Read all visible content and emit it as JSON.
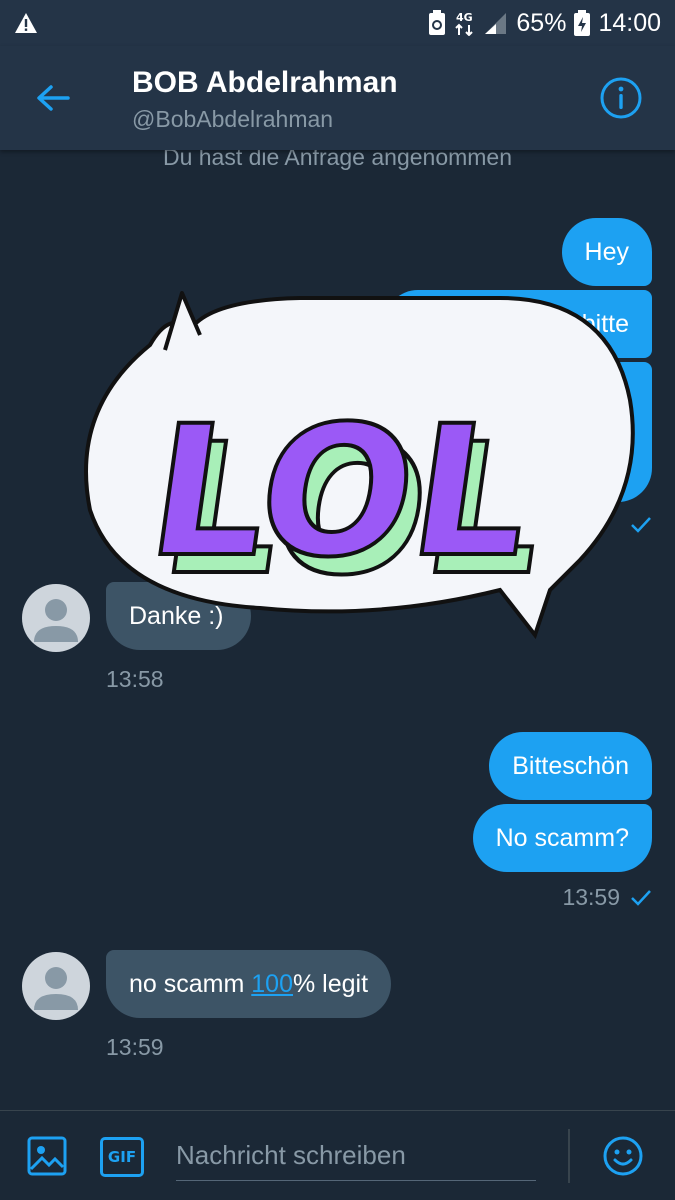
{
  "status_bar": {
    "battery": "65%",
    "time": "14:00",
    "network": "4G",
    "icons": [
      "warning-icon",
      "battery-saver-icon",
      "network-4g-icon",
      "signal-icon",
      "battery-charging-icon"
    ]
  },
  "header": {
    "name": "BOB Abdelrahman",
    "handle": "@BobAbdelrahman",
    "back_icon": "back-arrow-icon",
    "info_icon": "info-icon"
  },
  "conversation": {
    "system_note": "Du hast die Anfrage angenommen",
    "sent_group_1": [
      "Hey",
      "bitte"
    ],
    "received_1": {
      "text": "Danke :)",
      "time": "13:58"
    },
    "sent_group_2": {
      "messages": [
        "Bitteschön",
        "No scamm?"
      ],
      "time": "13:59"
    },
    "received_2": {
      "text_before": "no scamm ",
      "link": "100",
      "text_after": "% legit",
      "time": "13:59"
    },
    "sticker": {
      "text": "LOL",
      "fill": "#9b59f6",
      "side": "#a8efb8"
    }
  },
  "composer": {
    "placeholder": "Nachricht schreiben",
    "gif_label": "GIF",
    "icons": [
      "image-icon",
      "gif-icon",
      "emoji-icon"
    ]
  },
  "colors": {
    "background": "#1b2836",
    "header": "#243447",
    "accent": "#1da1f2",
    "received_bubble": "#3d5466",
    "muted_text": "#8899a6"
  }
}
